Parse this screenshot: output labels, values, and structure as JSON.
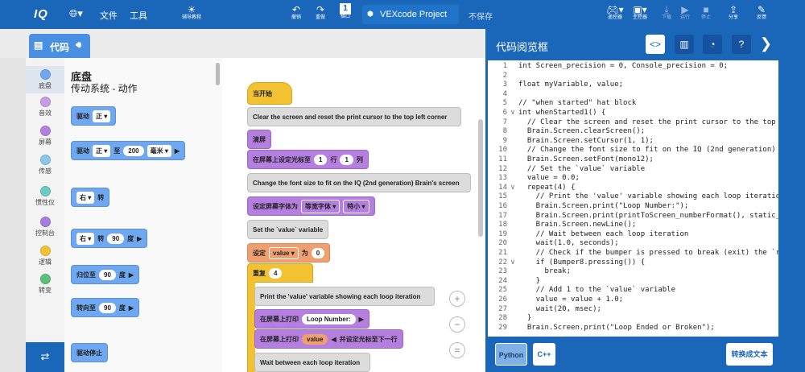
{
  "topbar": {
    "logo": "IQ",
    "menu_file": "文件",
    "menu_tools": "工具",
    "tutorials": "辅导教程",
    "undo": "撤销",
    "redo": "重做",
    "slot_number": "1",
    "slot_label": "插口",
    "project_name": "VEXcode Project",
    "unsaved": "不保存",
    "controller": "遥控器",
    "brain": "主控器",
    "download": "下载",
    "run": "运行",
    "stop": "停止",
    "share": "分享",
    "feedback": "反馈"
  },
  "code_tab": "代码",
  "categories": [
    {
      "label": "底盘",
      "color": "#6fa8f0"
    },
    {
      "label": "音效",
      "color": "#c69be8"
    },
    {
      "label": "屏幕",
      "color": "#b57fe0"
    },
    {
      "label": "传感",
      "color": "#8ac7e8"
    },
    {
      "label": "惯性仪",
      "color": "#6ccbc4"
    },
    {
      "label": "控制台",
      "color": "#a77de0"
    },
    {
      "label": "逻辑",
      "color": "#f3c233"
    },
    {
      "label": "转变",
      "color": "#5bc17a"
    }
  ],
  "palette": {
    "title": "底盘",
    "subtitle": "传动系统 - 动作",
    "b1": {
      "label": "驱动",
      "dir": "正"
    },
    "b2": {
      "label": "驱动",
      "dir": "正",
      "to": "至",
      "dist": "200",
      "unit": "毫米"
    },
    "b3": {
      "dir": "右",
      "label": "转"
    },
    "b4": {
      "dir": "右",
      "label": "转",
      "val": "90",
      "unit": "度"
    },
    "b5": {
      "label": "归位至",
      "val": "90",
      "unit": "度"
    },
    "b6": {
      "label": "转向至",
      "val": "90",
      "unit": "度"
    },
    "b7": {
      "label": "驱动停止"
    }
  },
  "workspace": {
    "hat": "当开始",
    "c1": "Clear the screen and reset the print cursor to the top left corner",
    "clear": "清屏",
    "setcursor": {
      "label": "在屏幕上设定光标至",
      "row": "1",
      "row_label": "行",
      "col": "1",
      "col_label": "列"
    },
    "c2": "Change the font size to fit on the IQ (2nd generation) Brain's screen",
    "font": {
      "label": "设定屏幕字体为",
      "font": "等宽字体",
      "size": "特小"
    },
    "c3": "Set the `value` variable",
    "set": {
      "label": "设定",
      "var": "value",
      "to": "为",
      "val": "0"
    },
    "repeat": {
      "label": "重复",
      "val": "4"
    },
    "c4": "Print the 'value' variable showing each loop iteration",
    "print1": {
      "label": "在屏幕上打印",
      "text": "Loop Number:"
    },
    "print2": {
      "label": "在屏幕上打印",
      "var": "value",
      "suffix": "并设定光标至下一行"
    },
    "c5": "Wait between each loop iteration"
  },
  "code_viewer": {
    "title": "代码阅览框",
    "lines": [
      {
        "n": "1",
        "fold": "",
        "text": "int Screen_precision = 0, Console_precision = 0;"
      },
      {
        "n": "2",
        "fold": "",
        "text": ""
      },
      {
        "n": "3",
        "fold": "",
        "text": "float myVariable, value;"
      },
      {
        "n": "4",
        "fold": "",
        "text": ""
      },
      {
        "n": "5",
        "fold": "",
        "text": "// \"when started\" hat block"
      },
      {
        "n": "6",
        "fold": "∨",
        "text": "int whenStarted1() {"
      },
      {
        "n": "7",
        "fold": "",
        "text": "  // Clear the screen and reset the print cursor to the top l"
      },
      {
        "n": "8",
        "fold": "",
        "text": "  Brain.Screen.clearScreen();"
      },
      {
        "n": "9",
        "fold": "",
        "text": "  Brain.Screen.setCursor(1, 1);"
      },
      {
        "n": "10",
        "fold": "",
        "text": "  // Change the font size to fit on the IQ (2nd generation) B"
      },
      {
        "n": "11",
        "fold": "",
        "text": "  Brain.Screen.setFont(mono12);"
      },
      {
        "n": "12",
        "fold": "",
        "text": "  // Set the `value` variable"
      },
      {
        "n": "13",
        "fold": "",
        "text": "  value = 0.0;"
      },
      {
        "n": "14",
        "fold": "∨",
        "text": "  repeat(4) {"
      },
      {
        "n": "15",
        "fold": "",
        "text": "    // Print the 'value' variable showing each loop iteratio"
      },
      {
        "n": "16",
        "fold": "",
        "text": "    Brain.Screen.print(\"Loop Number:\");"
      },
      {
        "n": "17",
        "fold": "",
        "text": "    Brain.Screen.print(printToScreen_numberFormat(), static_c"
      },
      {
        "n": "18",
        "fold": "",
        "text": "    Brain.Screen.newLine();"
      },
      {
        "n": "19",
        "fold": "",
        "text": "    // Wait between each loop iteration"
      },
      {
        "n": "20",
        "fold": "",
        "text": "    wait(1.0, seconds);"
      },
      {
        "n": "21",
        "fold": "",
        "text": "    // Check if the bumper is pressed to break (exit) the `re"
      },
      {
        "n": "22",
        "fold": "∨",
        "text": "    if (Bumper8.pressing()) {"
      },
      {
        "n": "23",
        "fold": "",
        "text": "      break;"
      },
      {
        "n": "24",
        "fold": "",
        "text": "    }"
      },
      {
        "n": "25",
        "fold": "",
        "text": "    // Add 1 to the `value` variable"
      },
      {
        "n": "26",
        "fold": "",
        "text": "    value = value + 1.0;"
      },
      {
        "n": "27",
        "fold": "",
        "text": "    wait(20, msec);"
      },
      {
        "n": "28",
        "fold": "",
        "text": "  }"
      },
      {
        "n": "29",
        "fold": "",
        "text": "  Brain.Screen.print(\"Loop Ended or Broken\");"
      }
    ],
    "python": "Python",
    "cpp": "C++",
    "convert": "转换成文本"
  }
}
